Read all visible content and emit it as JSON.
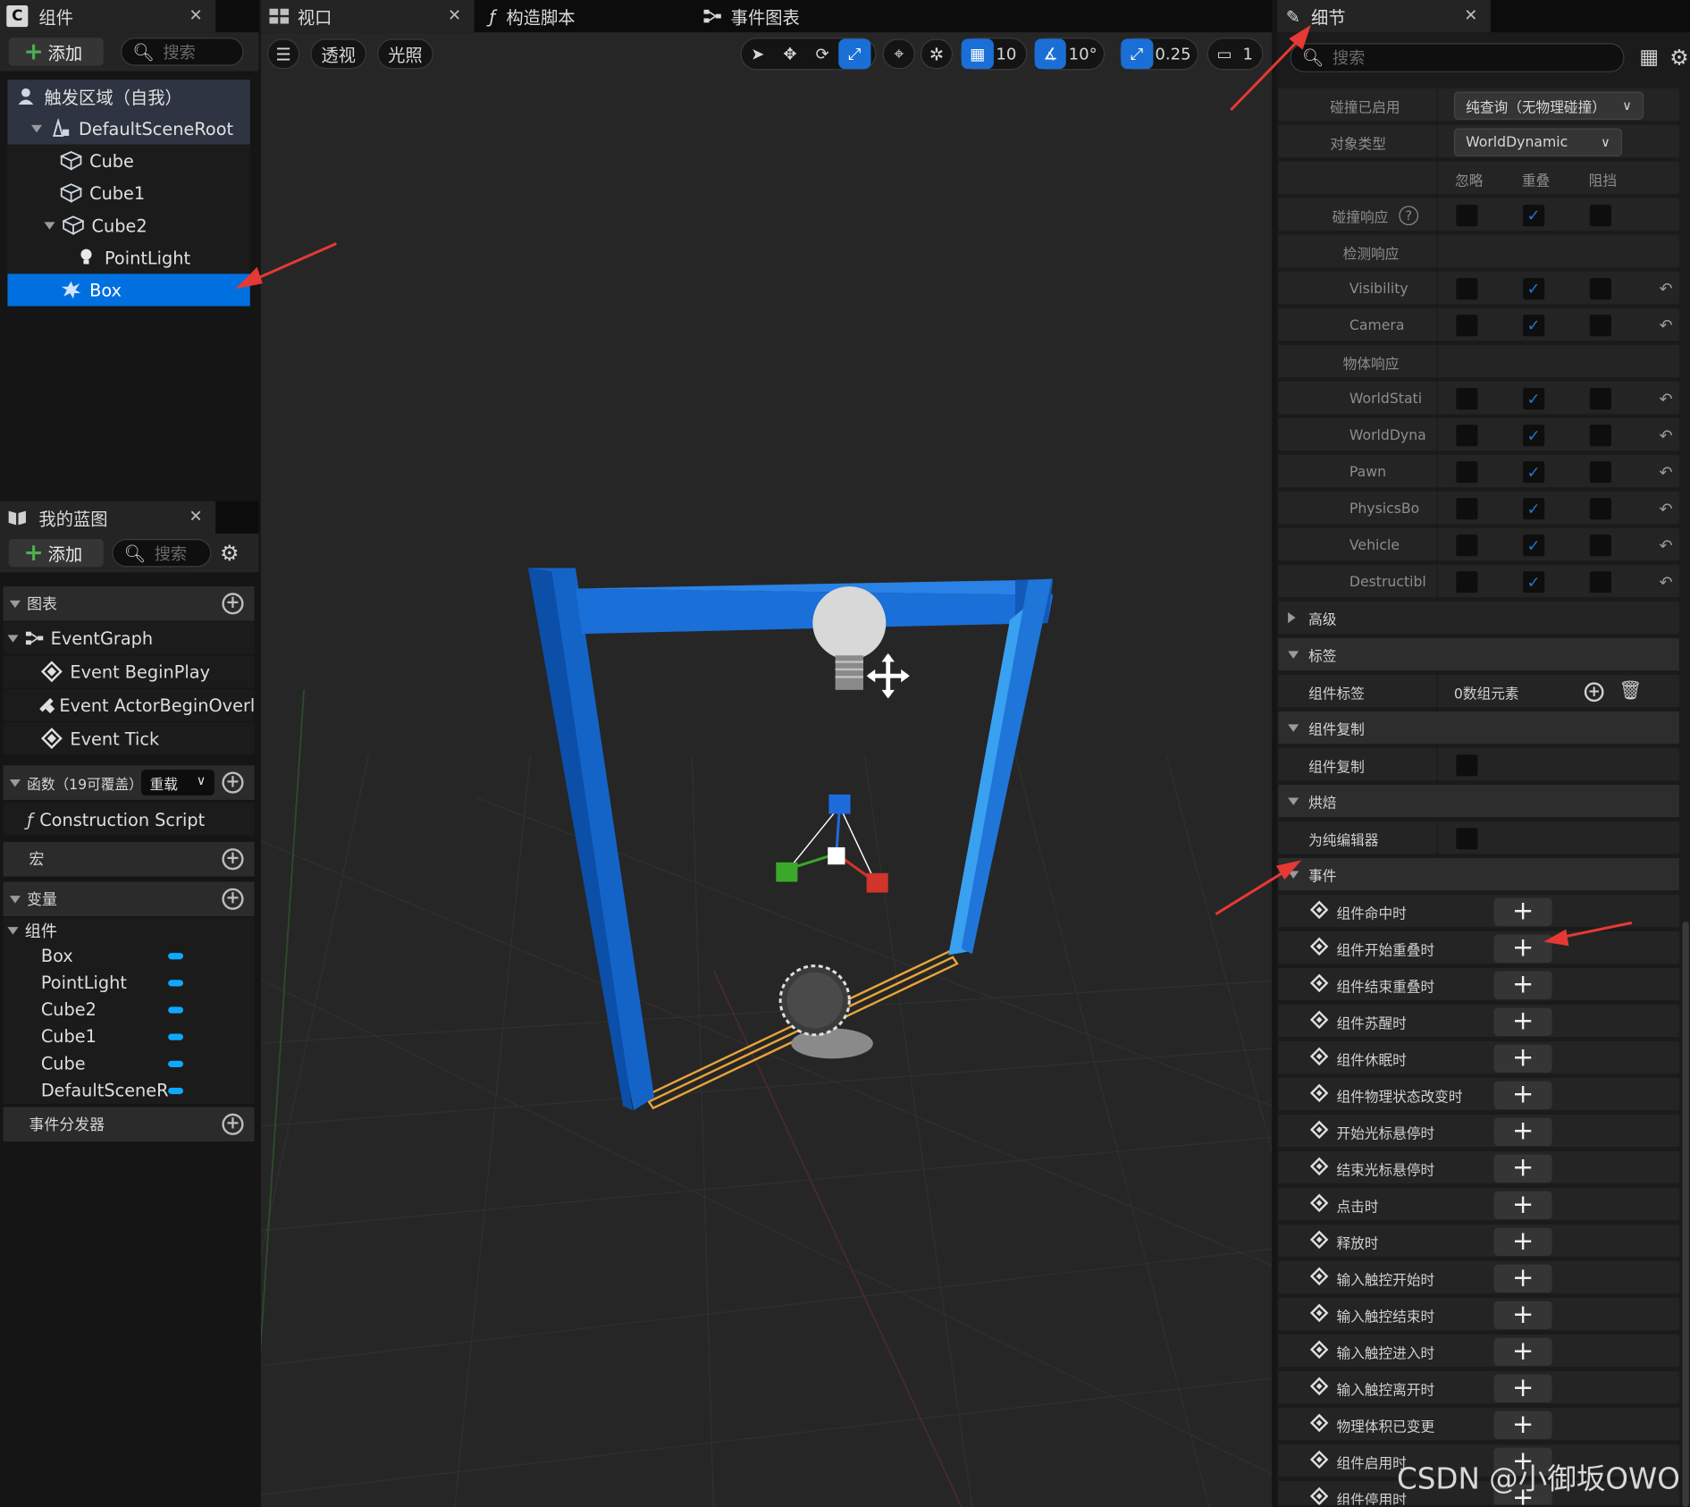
{
  "components_panel": {
    "tab_title": "组件",
    "add_label": "添加",
    "search_placeholder": "搜索",
    "tree": [
      {
        "label": "触发区域（自我）",
        "icon": "actor-icon"
      },
      {
        "label": "DefaultSceneRoot",
        "icon": "scene-root-icon"
      },
      {
        "label": "Cube",
        "icon": "cube-icon"
      },
      {
        "label": "Cube1",
        "icon": "cube-icon"
      },
      {
        "label": "Cube2",
        "icon": "cube-icon"
      },
      {
        "label": "PointLight",
        "icon": "bulb-icon"
      },
      {
        "label": "Box",
        "icon": "box-collision-icon"
      }
    ]
  },
  "blueprint_panel": {
    "tab_title": "我的蓝图",
    "add_label": "添加",
    "search_placeholder": "搜索",
    "graphs_label": "图表",
    "event_graph": "EventGraph",
    "events": [
      "Event BeginPlay",
      "Event ActorBeginOverla",
      "Event Tick"
    ],
    "functions_label": "函数（19可覆盖）",
    "override_label": "重载",
    "construction_script": "Construction Script",
    "macros_label": "宏",
    "variables_label": "变量",
    "components_label": "组件",
    "component_vars": [
      "Box",
      "PointLight",
      "Cube2",
      "Cube1",
      "Cube",
      "DefaultSceneR"
    ],
    "dispatchers_label": "事件分发器"
  },
  "viewport": {
    "tabs": [
      "视口",
      "构造脚本",
      "事件图表"
    ],
    "perspective_label": "透视",
    "lighting_label": "光照",
    "grid_snap": "10",
    "rotation_snap": "10°",
    "scale_snap": "0.25",
    "camera_speed": "1"
  },
  "details": {
    "tab_title": "细节",
    "search_placeholder": "搜索",
    "collision_enabled_label": "碰撞已启用",
    "collision_enabled_value": "纯查询（无物理碰撞）",
    "object_type_label": "对象类型",
    "object_type_value": "WorldDynamic",
    "col_ignore": "忽略",
    "col_overlap": "重叠",
    "col_block": "阻挡",
    "collision_responses_label": "碰撞响应",
    "trace_responses_label": "检测响应",
    "object_responses_label": "物体响应",
    "trace_channels": [
      "Visibility",
      "Camera"
    ],
    "object_channels": [
      "WorldStati",
      "WorldDyna",
      "Pawn",
      "PhysicsBo",
      "Vehicle",
      "Destructibl"
    ],
    "advanced_label": "高级",
    "tags_section": "标签",
    "component_tags_label": "组件标签",
    "component_tags_value": "0数组元素",
    "replication_section": "组件复制",
    "replication_label": "组件复制",
    "cooking_section": "烘焙",
    "editor_only_label": "为纯编辑器",
    "events_section": "事件",
    "events": [
      "组件命中时",
      "组件开始重叠时",
      "组件结束重叠时",
      "组件苏醒时",
      "组件休眠时",
      "组件物理状态改变时",
      "开始光标悬停时",
      "结束光标悬停时",
      "点击时",
      "释放时",
      "输入触控开始时",
      "输入触控结束时",
      "输入触控进入时",
      "输入触控离开时",
      "物理体积已变更",
      "组件启用时",
      "组件停用时"
    ]
  },
  "watermark": "CSDN @小御坂OWO",
  "colors": {
    "accent": "#0070e0",
    "selection": "#0070e0",
    "arrow": "#e53935",
    "var_pill": "#0fa8ff"
  }
}
